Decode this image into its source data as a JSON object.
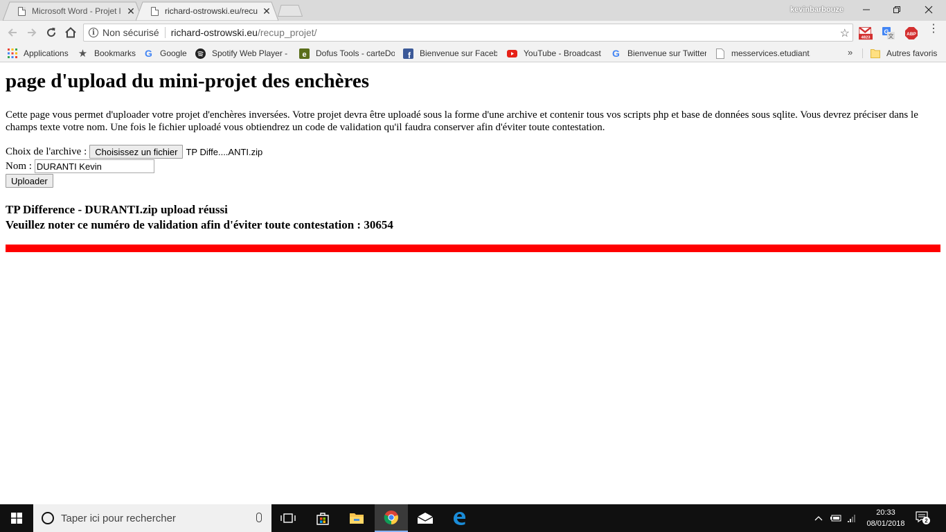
{
  "browser": {
    "tabs": [
      {
        "title": "Microsoft Word - Projet l",
        "active": false
      },
      {
        "title": "richard-ostrowski.eu/recup",
        "active": true
      }
    ],
    "profile_name": "kevinbarbouze",
    "window_controls": {
      "minimize": "—",
      "maximize": "❐",
      "close": "✕"
    },
    "address": {
      "security_label": "Non sécurisé",
      "host": "richard-ostrowski.eu",
      "path": "/recup_projet/"
    },
    "gmail_badge": "4823",
    "abp_label": "ABP",
    "bookmarks": [
      {
        "label": "Applications",
        "icon": "apps-grid-icon"
      },
      {
        "label": "Bookmarks",
        "icon": "star-icon"
      },
      {
        "label": "Google",
        "icon": "google-icon"
      },
      {
        "label": "Spotify Web Player -",
        "icon": "spotify-icon"
      },
      {
        "label": "Dofus Tools - carteDo",
        "icon": "dofus-icon"
      },
      {
        "label": "Bienvenue sur Facebo",
        "icon": "facebook-icon"
      },
      {
        "label": "YouTube - Broadcast",
        "icon": "youtube-icon"
      },
      {
        "label": "Bienvenue sur Twitter",
        "icon": "google-icon"
      },
      {
        "label": "messervices.etudiant.",
        "icon": "page-icon"
      }
    ],
    "bookmarks_overflow": "»",
    "other_bookmarks": "Autres favoris"
  },
  "page": {
    "title": "page d'upload du mini-projet des enchères",
    "intro": "Cette page vous permet d'uploader votre projet d'enchères inversées. Votre projet devra être uploadé sous la forme d'une archive et contenir tous vos scripts php et base de données sous sqlite. Vous devrez préciser dans le champs texte votre nom. Une fois le fichier uploadé vous obtiendrez un code de validation qu'il faudra conserver afin d'éviter toute contestation.",
    "form": {
      "archive_label": "Choix de l'archive :",
      "file_button": "Choisissez un fichier",
      "file_chosen": "TP Diffe....ANTI.zip",
      "name_label": "Nom :",
      "name_value": "DURANTI Kevin",
      "submit": "Uploader"
    },
    "result": {
      "line1": "TP Difference - DURANTI.zip upload réussi",
      "line2": "Veuillez noter ce numéro de validation afin d'éviter toute contestation : 30654"
    },
    "bar_color": "#ff0000"
  },
  "taskbar": {
    "search_placeholder": "Taper ici pour rechercher",
    "time": "20:33",
    "date": "08/01/2018",
    "notification_count": "2"
  }
}
